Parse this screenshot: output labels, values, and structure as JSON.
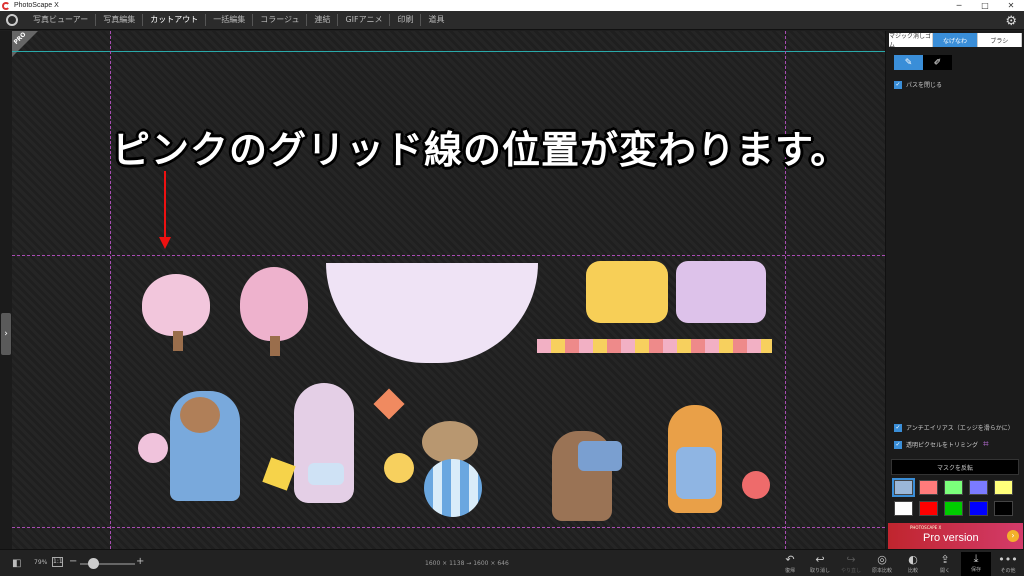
{
  "window": {
    "title": "PhotoScape X",
    "min": "─",
    "max": "□",
    "close": "✕"
  },
  "menu": {
    "items": [
      {
        "label": "写真ビューアー",
        "active": false
      },
      {
        "label": "写真編集",
        "active": false
      },
      {
        "label": "カットアウト",
        "active": true
      },
      {
        "label": "一括編集",
        "active": false
      },
      {
        "label": "コラージュ",
        "active": false
      },
      {
        "label": "連結",
        "active": false
      },
      {
        "label": "GIFアニメ",
        "active": false
      },
      {
        "label": "印刷",
        "active": false
      },
      {
        "label": "道具",
        "active": false
      }
    ]
  },
  "canvas": {
    "badge": "PRO",
    "caption": "ピンクのグリッド線の位置が変わります。"
  },
  "panel": {
    "tabs": [
      {
        "label": "マジック消しゴム",
        "active": false
      },
      {
        "label": "なげなわ",
        "active": true
      },
      {
        "label": "ブラシ",
        "active": false
      }
    ],
    "close_path_label": "パスを閉じる",
    "antialias_label": "アンチエイリアス（エッジを滑らかに）",
    "trim_label": "透明ピクセルをトリミング",
    "invert_mask_label": "マスクを反転",
    "swatch_colors": [
      "#9ab7d8",
      "#ff7b7b",
      "#7bff7b",
      "#7b7bff",
      "#ffff7b",
      "#ffffff",
      "#ff0000",
      "#00cc00",
      "#0000ff",
      "#000000"
    ],
    "ad_small": "PHOTOSCAPE X",
    "ad_text": "Pro version"
  },
  "bottom": {
    "zoom": "79%",
    "one_to_one": "1:1",
    "minus": "−",
    "plus": "+",
    "dimensions": "1600 × 1138 → 1600 × 646",
    "tools": [
      {
        "label": "復帰",
        "icon": "↶",
        "disabled": false
      },
      {
        "label": "取り消し",
        "icon": "↩",
        "disabled": false
      },
      {
        "label": "やり直し",
        "icon": "↪",
        "disabled": true
      },
      {
        "label": "原本比較",
        "icon": "◎",
        "disabled": false
      },
      {
        "label": "比較",
        "icon": "◐",
        "disabled": false
      },
      {
        "label": "開く",
        "icon": "⇪",
        "disabled": false
      },
      {
        "label": "保存",
        "icon": "⤓",
        "disabled": false
      },
      {
        "label": "その他",
        "icon": "•••",
        "disabled": false
      }
    ]
  }
}
